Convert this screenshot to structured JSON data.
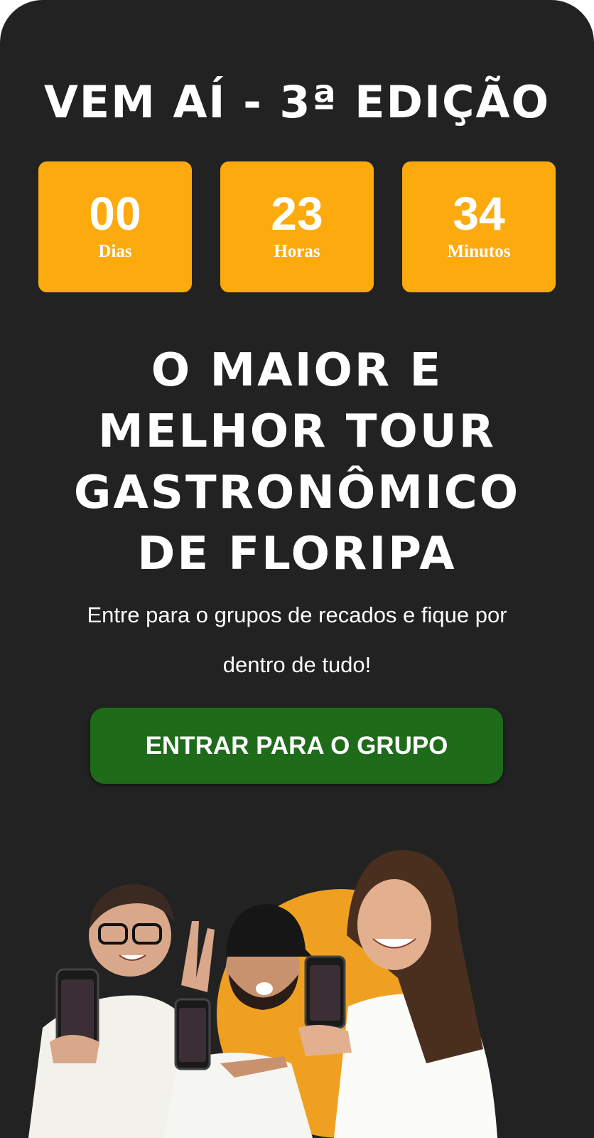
{
  "header": {
    "edition_title": "VEM AÍ - 3ª EDIÇÃO"
  },
  "countdown": {
    "days": {
      "value": "00",
      "label": "Dias"
    },
    "hours": {
      "value": "23",
      "label": "Horas"
    },
    "minutes": {
      "value": "34",
      "label": "Minutos"
    }
  },
  "headline": {
    "line1": "O MAIOR E",
    "line2": "MELHOR TOUR",
    "line3": "GASTRONÔMICO",
    "line4": "DE FLORIPA"
  },
  "subtext": {
    "line1": "Entre para o grupos de recados e fique por",
    "line2": "dentro de tudo!"
  },
  "cta": {
    "label": "ENTRAR PARA O GRUPO"
  },
  "colors": {
    "background": "#222222",
    "countdown_box": "#fcaa0d",
    "cta_button": "#1e6b1a",
    "text": "#ffffff"
  }
}
